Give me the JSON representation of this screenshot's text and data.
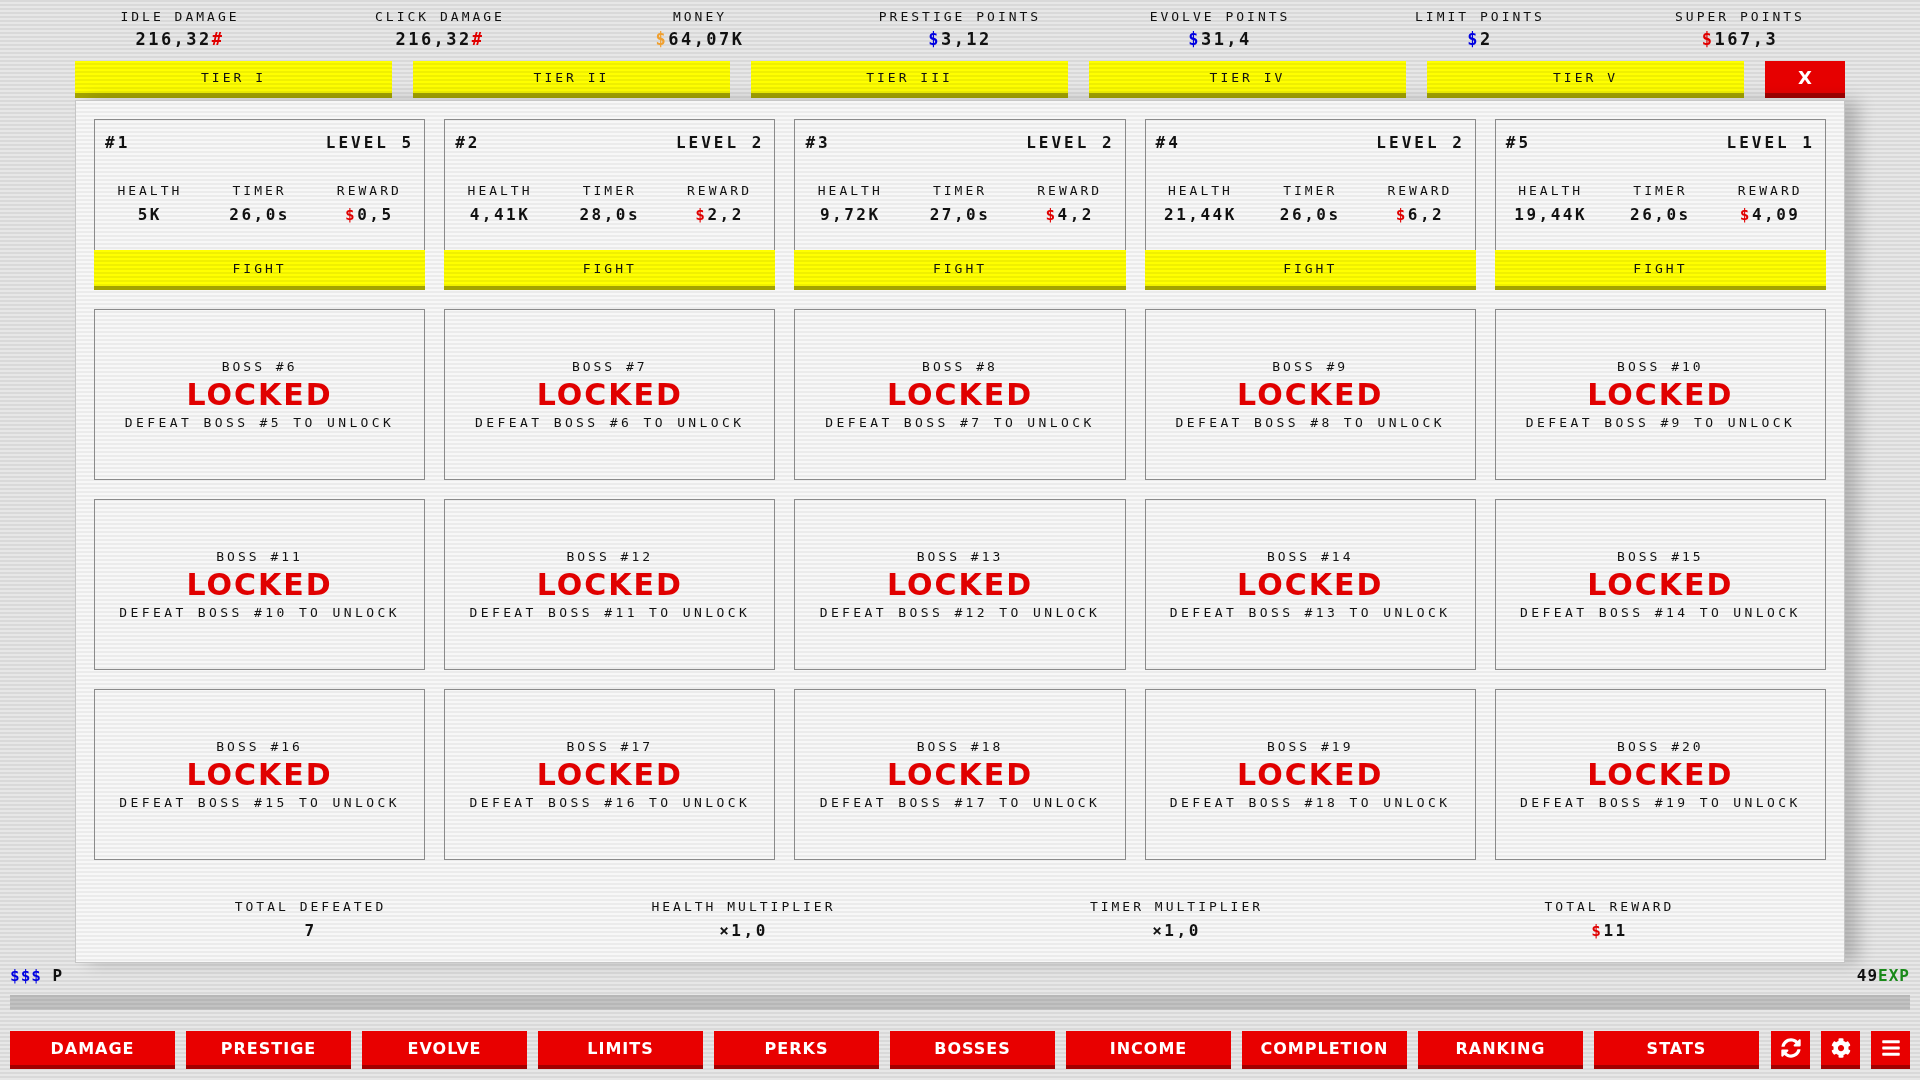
{
  "stats": [
    {
      "label": "IDLE DAMAGE",
      "amount": "216,32",
      "suffix": "#",
      "color": "#e00000"
    },
    {
      "label": "CLICK DAMAGE",
      "amount": "216,32",
      "suffix": "#",
      "color": "#e00000"
    },
    {
      "label": "MONEY",
      "prefix": "$",
      "amount": "64,07K",
      "color": "#f0a030"
    },
    {
      "label": "PRESTIGE POINTS",
      "prefix": "$",
      "amount": "3,12",
      "color": "#0000e0"
    },
    {
      "label": "EVOLVE POINTS",
      "prefix": "$",
      "amount": "31,4",
      "color": "#0000e0"
    },
    {
      "label": "LIMIT POINTS",
      "prefix": "$",
      "amount": "2",
      "color": "#0000e0"
    },
    {
      "label": "SUPER POINTS",
      "prefix": "$",
      "amount": "167,3",
      "color": "#e00000"
    }
  ],
  "tiers": [
    "TIER I",
    "TIER II",
    "TIER III",
    "TIER IV",
    "TIER V"
  ],
  "close_button": "X",
  "bosses": [
    {
      "kind": "unlocked",
      "number": "#1",
      "level": "LEVEL 5",
      "stats": [
        {
          "label": "HEALTH",
          "value": "5K"
        },
        {
          "label": "TIMER",
          "value": "26,0s"
        },
        {
          "label": "REWARD",
          "prefix": "$",
          "value": "0,5"
        }
      ],
      "button": "FIGHT"
    },
    {
      "kind": "unlocked",
      "number": "#2",
      "level": "LEVEL 2",
      "stats": [
        {
          "label": "HEALTH",
          "value": "4,41K"
        },
        {
          "label": "TIMER",
          "value": "28,0s"
        },
        {
          "label": "REWARD",
          "prefix": "$",
          "value": "2,2"
        }
      ],
      "button": "FIGHT"
    },
    {
      "kind": "unlocked",
      "number": "#3",
      "level": "LEVEL 2",
      "stats": [
        {
          "label": "HEALTH",
          "value": "9,72K"
        },
        {
          "label": "TIMER",
          "value": "27,0s"
        },
        {
          "label": "REWARD",
          "prefix": "$",
          "value": "4,2"
        }
      ],
      "button": "FIGHT"
    },
    {
      "kind": "unlocked",
      "number": "#4",
      "level": "LEVEL 2",
      "stats": [
        {
          "label": "HEALTH",
          "value": "21,44K"
        },
        {
          "label": "TIMER",
          "value": "26,0s"
        },
        {
          "label": "REWARD",
          "prefix": "$",
          "value": "6,2"
        }
      ],
      "button": "FIGHT"
    },
    {
      "kind": "unlocked",
      "number": "#5",
      "level": "LEVEL 1",
      "stats": [
        {
          "label": "HEALTH",
          "value": "19,44K"
        },
        {
          "label": "TIMER",
          "value": "26,0s"
        },
        {
          "label": "REWARD",
          "prefix": "$",
          "value": "4,09"
        }
      ],
      "button": "FIGHT"
    },
    {
      "kind": "locked",
      "title": "BOSS #6",
      "status": "LOCKED",
      "hint": "DEFEAT BOSS #5 TO UNLOCK"
    },
    {
      "kind": "locked",
      "title": "BOSS #7",
      "status": "LOCKED",
      "hint": "DEFEAT BOSS #6 TO UNLOCK"
    },
    {
      "kind": "locked",
      "title": "BOSS #8",
      "status": "LOCKED",
      "hint": "DEFEAT BOSS #7 TO UNLOCK"
    },
    {
      "kind": "locked",
      "title": "BOSS #9",
      "status": "LOCKED",
      "hint": "DEFEAT BOSS #8 TO UNLOCK"
    },
    {
      "kind": "locked",
      "title": "BOSS #10",
      "status": "LOCKED",
      "hint": "DEFEAT BOSS #9 TO UNLOCK"
    },
    {
      "kind": "locked",
      "title": "BOSS #11",
      "status": "LOCKED",
      "hint": "DEFEAT BOSS #10 TO UNLOCK"
    },
    {
      "kind": "locked",
      "title": "BOSS #12",
      "status": "LOCKED",
      "hint": "DEFEAT BOSS #11 TO UNLOCK"
    },
    {
      "kind": "locked",
      "title": "BOSS #13",
      "status": "LOCKED",
      "hint": "DEFEAT BOSS #12 TO UNLOCK"
    },
    {
      "kind": "locked",
      "title": "BOSS #14",
      "status": "LOCKED",
      "hint": "DEFEAT BOSS #13 TO UNLOCK"
    },
    {
      "kind": "locked",
      "title": "BOSS #15",
      "status": "LOCKED",
      "hint": "DEFEAT BOSS #14 TO UNLOCK"
    },
    {
      "kind": "locked",
      "title": "BOSS #16",
      "status": "LOCKED",
      "hint": "DEFEAT BOSS #15 TO UNLOCK"
    },
    {
      "kind": "locked",
      "title": "BOSS #17",
      "status": "LOCKED",
      "hint": "DEFEAT BOSS #16 TO UNLOCK"
    },
    {
      "kind": "locked",
      "title": "BOSS #18",
      "status": "LOCKED",
      "hint": "DEFEAT BOSS #17 TO UNLOCK"
    },
    {
      "kind": "locked",
      "title": "BOSS #19",
      "status": "LOCKED",
      "hint": "DEFEAT BOSS #18 TO UNLOCK"
    },
    {
      "kind": "locked",
      "title": "BOSS #20",
      "status": "LOCKED",
      "hint": "DEFEAT BOSS #19 TO UNLOCK"
    }
  ],
  "summary": [
    {
      "label": "TOTAL DEFEATED",
      "value": "7"
    },
    {
      "label": "HEALTH MULTIPLIER",
      "value": "×1,0"
    },
    {
      "label": "TIMER MULTIPLIER",
      "value": "×1,0"
    },
    {
      "label": "TOTAL REWARD",
      "prefix": "$",
      "value": "11"
    }
  ],
  "background_text": {
    "left": {
      "prefix": "$$$",
      "text": "P"
    },
    "right": {
      "amount": "49",
      "suffix": "EXP"
    }
  },
  "nav": [
    "DAMAGE",
    "PRESTIGE",
    "EVOLVE",
    "LIMITS",
    "PERKS",
    "BOSSES",
    "INCOME",
    "COMPLETION",
    "RANKING",
    "STATS"
  ]
}
